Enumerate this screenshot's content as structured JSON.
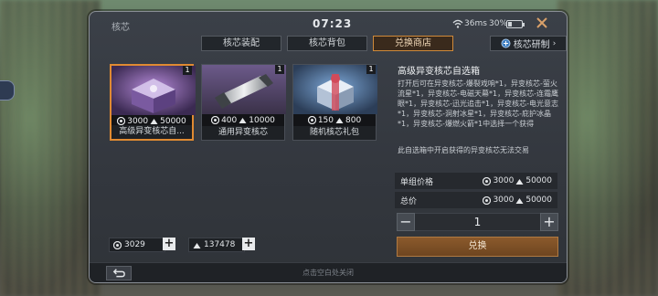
{
  "window": {
    "title": "核芯",
    "clock": "07:23",
    "ping": "36ms",
    "battery": "30%",
    "battery_level": 0.3
  },
  "tabs": [
    {
      "label": "核芯装配",
      "active": false
    },
    {
      "label": "核芯背包",
      "active": false
    },
    {
      "label": "兑换商店",
      "active": true
    }
  ],
  "research_button": "核芯研制",
  "items": [
    {
      "name": "高级异变核芯自...",
      "qty": "1",
      "price_silver": "3000",
      "price_tokens": "50000",
      "selected": true,
      "art": "purple-chest"
    },
    {
      "name": "通用异变核芯",
      "qty": "1",
      "price_silver": "400",
      "price_tokens": "10000",
      "selected": false,
      "art": "core-cylinder"
    },
    {
      "name": "随机核芯礼包",
      "qty": "1",
      "price_silver": "150",
      "price_tokens": "800",
      "selected": false,
      "art": "blue-chest"
    }
  ],
  "detail": {
    "title": "高级异变核芯自选箱",
    "description": "打开后可在异变核芯-爆裂戏响*1，异变核芯-萤火流星*1，异变核芯-电磁天幕*1，异变核芯-连霜鹰眼*1，异变核芯-迅光追击*1，异变核芯-电光意志*1，异变核芯-洞射冰星*1，异变核芯-庇护冰晶*1，异变核芯-爆燃火箭*1中选择一个获得",
    "note": "此自选箱中开启获得的异变核芯无法交易",
    "unit_price_label": "单组价格",
    "unit_price_silver": "3000",
    "unit_price_tokens": "50000",
    "total_label": "总价",
    "total_silver": "3000",
    "total_tokens": "50000",
    "quantity": "1",
    "minus": "−",
    "plus": "+",
    "redeem_label": "兑换"
  },
  "currency": {
    "silver": "3029",
    "tokens": "137478",
    "add": "+"
  },
  "footer_hint": "点击空白处关闭",
  "colors": {
    "accent": "#e08a32",
    "panel": "#3b4048",
    "button": "#7a4c24"
  }
}
